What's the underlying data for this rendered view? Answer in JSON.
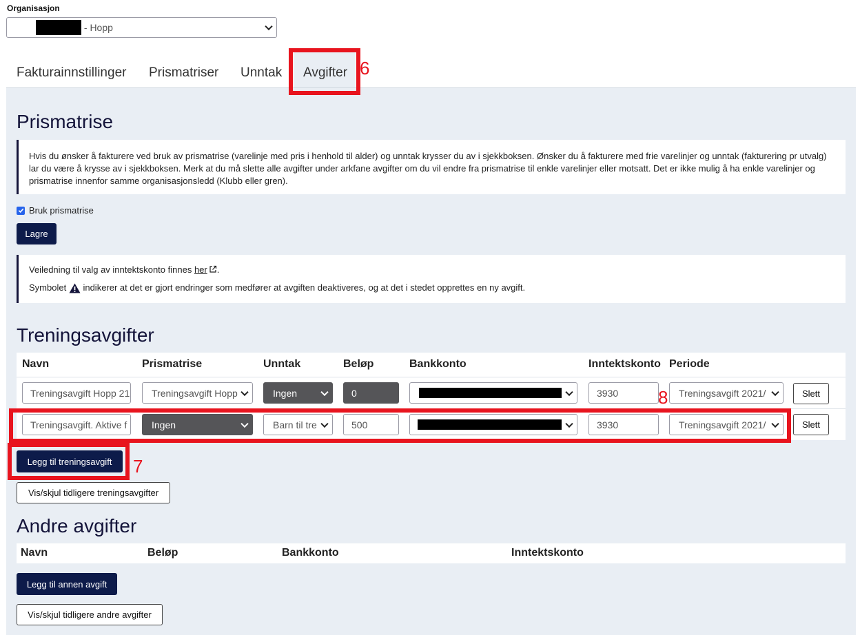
{
  "organisation": {
    "label": "Organisasjon",
    "selected_suffix": " - Hopp"
  },
  "tabs": [
    {
      "label": "Fakturainnstillinger"
    },
    {
      "label": "Prismatriser"
    },
    {
      "label": "Unntak"
    },
    {
      "label": "Avgifter"
    }
  ],
  "annotations": {
    "tab_marker": "6",
    "add_marker": "7",
    "row_marker": "8",
    "color": "#e8141e"
  },
  "prismatrise": {
    "heading": "Prismatrise",
    "info_text": "Hvis du ønsker å fakturere ved bruk av prismatrise (varelinje med pris i henhold til alder) og unntak krysser du av i sjekkboksen. Ønsker du å fakturere med frie varelinjer og unntak (fakturering pr utvalg) lar du være å krysse av i sjekkboksen. Merk at du må slette alle avgifter under arkfane avgifter om du vil endre fra prismatrise til enkle varelinjer eller motsatt. Det er ikke mulig å ha enkle varelinjer og prismatrise innenfor samme organisasjonsledd (Klubb eller gren).",
    "checkbox_label": "Bruk prismatrise",
    "save_label": "Lagre"
  },
  "guide": {
    "line1_prefix": "Veiledning til valg av inntektskonto finnes ",
    "line1_link": "her",
    "line1_suffix": ".",
    "line2_prefix": "Symbolet",
    "line2_suffix": "indikerer at det er gjort endringer som medfører at avgiften deaktiveres, og at det i stedet opprettes en ny avgift."
  },
  "training": {
    "heading": "Treningsavgifter",
    "columns": [
      "Navn",
      "Prismatrise",
      "Unntak",
      "Beløp",
      "Bankkonto",
      "Inntektskonto",
      "Periode"
    ],
    "rows": [
      {
        "navn": "Treningsavgift Hopp 21",
        "prismatrise": "Treningsavgift Hopp",
        "unntak": "Ingen",
        "belop": "0",
        "inntektskonto": "3930",
        "periode": "Treningsavgift 2021/",
        "delete": "Slett"
      },
      {
        "navn": "Treningsavgift. Aktive f",
        "prismatrise": "Ingen",
        "unntak": "Barn til tre",
        "belop": "500",
        "inntektskonto": "3930",
        "periode": "Treningsavgift 2021/",
        "delete": "Slett"
      }
    ],
    "add_label": "Legg til treningsavgift",
    "toggle_label": "Vis/skjul tidligere treningsavgifter"
  },
  "other": {
    "heading": "Andre avgifter",
    "columns": [
      "Navn",
      "Beløp",
      "Bankkonto",
      "Inntektskonto"
    ],
    "add_label": "Legg til annen avgift",
    "toggle_label": "Vis/skjul tidligere andre avgifter"
  }
}
